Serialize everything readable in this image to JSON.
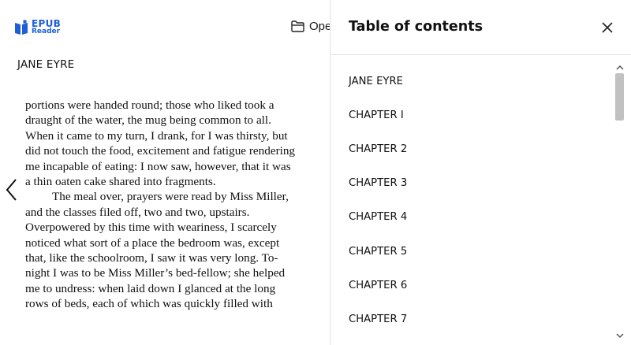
{
  "app": {
    "logo_line1": "EPUB",
    "logo_line2": "Reader",
    "open_label": "Ope",
    "book_title": "JANE EYRE"
  },
  "page": {
    "paragraph_1": "portions were handed round; those who liked took a draught of the water, the mug being common to all. When it came to my turn, I drank, for I was thirsty, but did not touch the food, excitement and fatigue rendering me incapable of eating: I now saw, however, that it was a thin oaten cake shared into fragments.",
    "paragraph_2": "The meal over, prayers were read by Miss Miller, and the classes filed off, two and two, upstairs. Overpowered by this time with weariness, I scarcely noticed what sort of a place the bedroom was, except that, like the schoolroom, I saw it was very long. To-night I was to be Miss Miller’s bed-fellow; she helped me to undress: when laid down I glanced at the long rows of beds, each of which was quickly filled with"
  },
  "toc": {
    "title": "Table of contents",
    "items": [
      "JANE EYRE",
      "CHAPTER I",
      "CHAPTER 2",
      "CHAPTER 3",
      "CHAPTER 4",
      "CHAPTER 5",
      "CHAPTER 6",
      "CHAPTER 7"
    ]
  },
  "icons": {
    "logo": "book-icon",
    "open": "folder-icon",
    "prev": "chevron-left-icon",
    "close": "close-icon"
  },
  "colors": {
    "brand": "#1f5fd6",
    "text": "#111111",
    "divider": "#e2e2e2",
    "scroll_thumb": "#c1c1c1"
  }
}
